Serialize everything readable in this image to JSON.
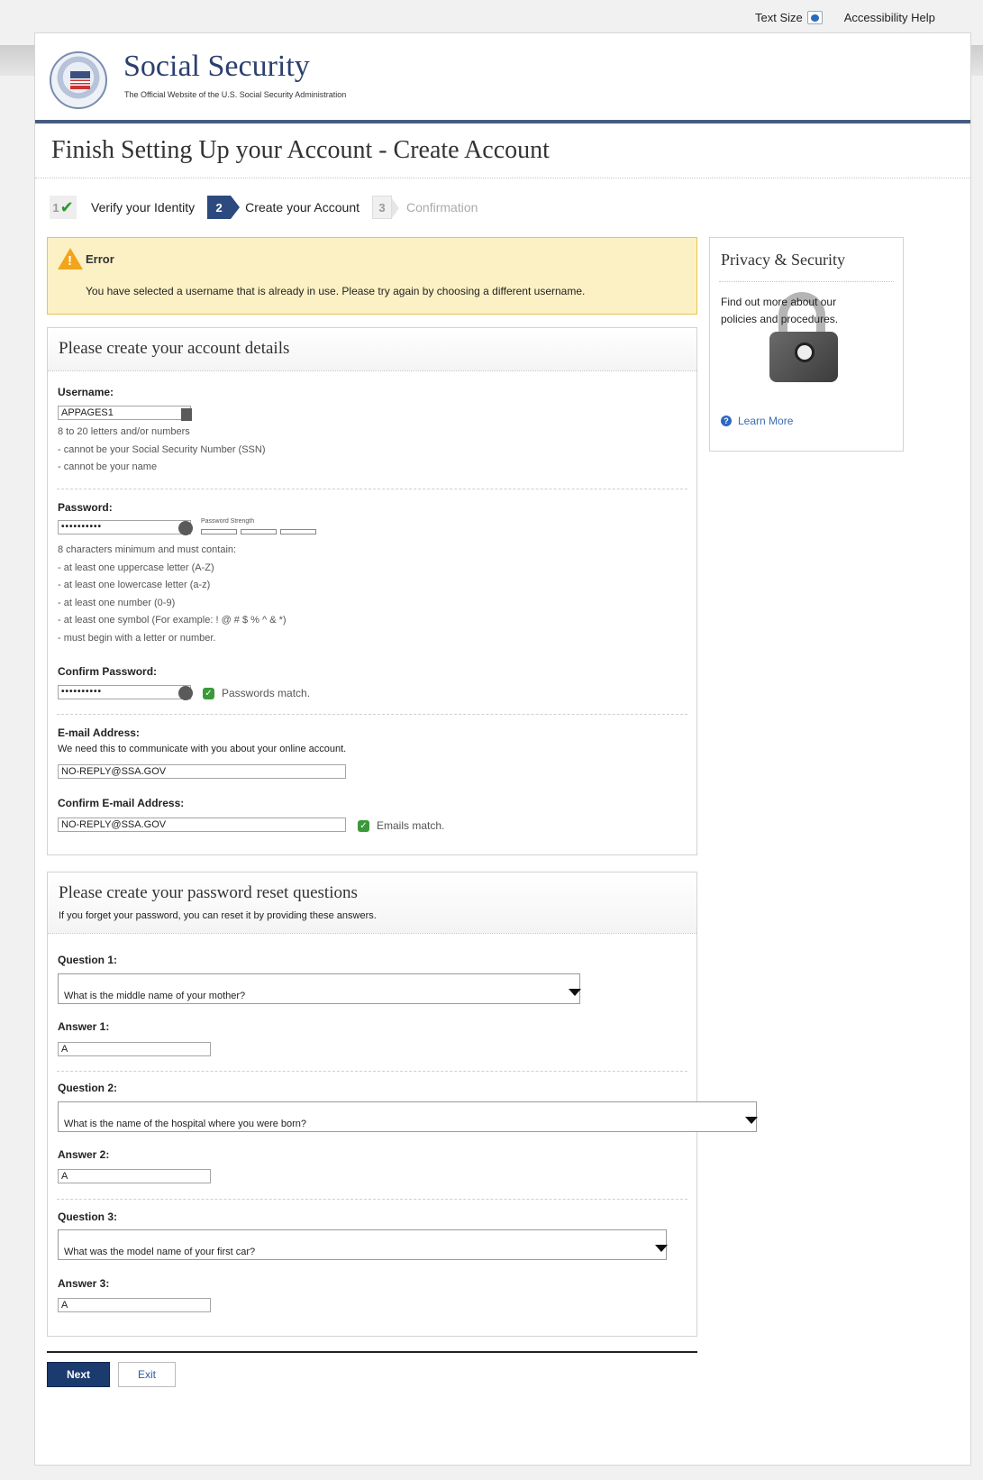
{
  "utility": {
    "text_size": "Text Size",
    "accessibility_help": "Accessibility Help"
  },
  "brand": {
    "title": "Social Security",
    "subtitle": "The Official Website of the U.S. Social Security Administration"
  },
  "page_title": "Finish Setting Up your Account - Create Account",
  "steps": [
    {
      "num": "1",
      "label": "Verify your Identity",
      "state": "done"
    },
    {
      "num": "2",
      "label": "Create your Account",
      "state": "current"
    },
    {
      "num": "3",
      "label": "Confirmation",
      "state": "future"
    }
  ],
  "error": {
    "title": "Error",
    "message": "You have selected a username that is already in use. Please try again by choosing a different username."
  },
  "sidebar": {
    "title": "Privacy & Security",
    "text": "Find out more about our policies and procedures.",
    "link": "Learn More"
  },
  "account": {
    "title": "Please create your account details",
    "username_label": "Username:",
    "username_value": "APPAGES1",
    "username_hints": [
      "8 to 20 letters and/or numbers",
      "- cannot be your Social Security Number (SSN)",
      "- cannot be your name"
    ],
    "password_label": "Password:",
    "password_value": "••••••••••",
    "strength_label": "Password Strength",
    "password_hints": [
      "8 characters minimum and must contain:",
      "- at least one uppercase letter (A-Z)",
      "- at least one lowercase letter (a-z)",
      "- at least one number (0-9)",
      "- at least one symbol (For example: ! @ # $ % ^ & *)",
      "- must begin with a letter or number."
    ],
    "confirm_password_label": "Confirm Password:",
    "confirm_password_value": "••••••••••",
    "passwords_match": "Passwords match.",
    "email_label": "E-mail Address:",
    "email_hint": "We need this to communicate with you about your online account.",
    "email_value": "NO-REPLY@SSA.GOV",
    "confirm_email_label": "Confirm E-mail Address:",
    "confirm_email_value": "NO-REPLY@SSA.GOV",
    "emails_match": "Emails match."
  },
  "reset": {
    "title": "Please create your password reset questions",
    "subtitle": "If you forget your password, you can reset it by providing these answers.",
    "q1_label": "Question 1:",
    "q1_value": "What is the middle name of your mother?",
    "a1_label": "Answer 1:",
    "a1_value": "A",
    "q2_label": "Question 2:",
    "q2_value": "What is the name of the hospital where you were born?",
    "a2_label": "Answer 2:",
    "a2_value": "A",
    "q3_label": "Question 3:",
    "q3_value": "What was the model name of your first car?",
    "a3_label": "Answer 3:",
    "a3_value": "A"
  },
  "buttons": {
    "next": "Next",
    "exit": "Exit"
  },
  "colors": {
    "brand_navy": "#2c3f6e",
    "error_bg": "#fcf1c4",
    "success_green": "#3a9a3a",
    "link_blue": "#3b6bb5"
  }
}
